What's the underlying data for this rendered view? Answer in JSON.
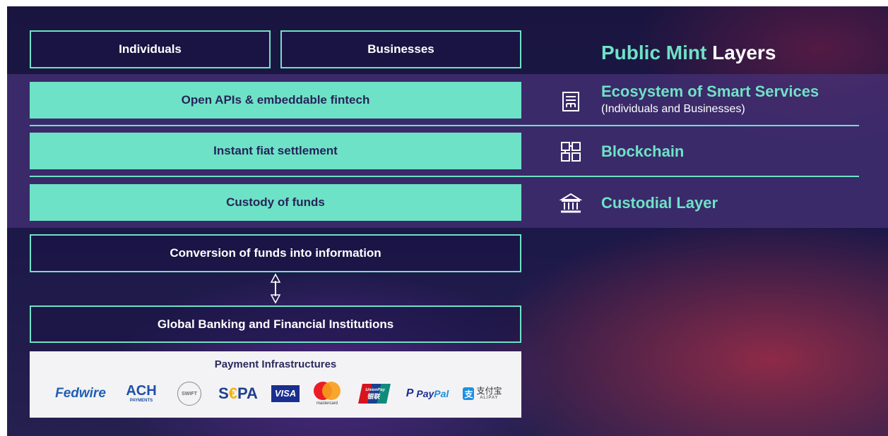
{
  "diagram": {
    "top_boxes": [
      "Individuals",
      "Businesses"
    ],
    "layers": [
      {
        "box": "Open APIs & embeddable fintech",
        "icon": "smart-services-icon",
        "name": "Ecosystem of Smart Services",
        "sub": "(Individuals and Businesses)"
      },
      {
        "box": "Instant fiat settlement",
        "icon": "blockchain-icon",
        "name": "Blockchain"
      },
      {
        "box": "Custody of funds",
        "icon": "bank-building-icon",
        "name": "Custodial Layer"
      }
    ],
    "conversion": "Conversion of funds into information",
    "banking": "Global Banking and Financial Institutions",
    "title_mint": "Public Mint",
    "title_rest": "Layers"
  },
  "payments": {
    "title": "Payment Infrastructures",
    "logos": {
      "fedwire": "Fedwire",
      "ach": "ACH",
      "ach_sub": "PAYMENTS",
      "swift": "SWIFT",
      "sepa_s": "S",
      "sepa_e": "€",
      "sepa_pa": "PA",
      "visa": "VISA",
      "mastercard": "mastercard",
      "unionpay": "UnionPay",
      "unionpay_cn": "银联",
      "paypal_pay": "Pay",
      "paypal_pal": "Pal",
      "alipay_cn": "支付宝",
      "alipay": "ALIPAY"
    }
  },
  "colors": {
    "mint": "#6ee2c6",
    "navy": "#26245a",
    "background": "#1c1848",
    "band": "#463278"
  }
}
